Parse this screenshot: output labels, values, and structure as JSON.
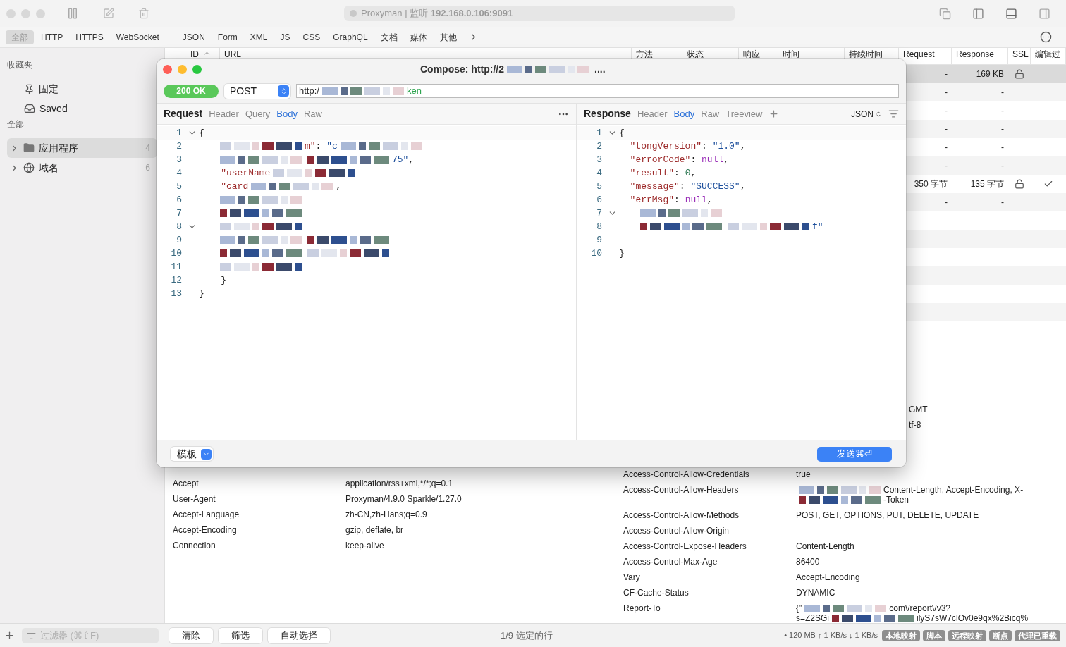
{
  "titlebar": {
    "title": "Proxyman | 监听 **192.168.0.106:9091**"
  },
  "filters": [
    {
      "kind": "tab",
      "label": "全部",
      "selected": true
    },
    {
      "kind": "tab",
      "label": "HTTP",
      "selected": false
    },
    {
      "kind": "tab",
      "label": "HTTPS",
      "selected": false
    },
    {
      "kind": "tab",
      "label": "WebSocket",
      "selected": false
    },
    {
      "kind": "separator"
    },
    {
      "kind": "tab",
      "label": "JSON",
      "selected": false
    },
    {
      "kind": "tab",
      "label": "Form",
      "selected": false
    },
    {
      "kind": "tab",
      "label": "XML",
      "selected": false
    },
    {
      "kind": "tab",
      "label": "JS",
      "selected": false
    },
    {
      "kind": "tab",
      "label": "CSS",
      "selected": false
    },
    {
      "kind": "tab",
      "label": "GraphQL",
      "selected": false
    },
    {
      "kind": "tab",
      "label": "文档",
      "selected": false
    },
    {
      "kind": "tab",
      "label": "媒体",
      "selected": false
    },
    {
      "kind": "tab",
      "label": "其他",
      "selected": false
    }
  ],
  "sidebar": {
    "sections": [
      {
        "title": "收藏夹",
        "items": [
          {
            "kind": "pin",
            "label": "固定",
            "selected": false
          },
          {
            "kind": "tray",
            "label": "Saved",
            "selected": false
          }
        ]
      },
      {
        "title": "全部",
        "items": [
          {
            "kind": "folder",
            "label": "应用程序",
            "count": "4",
            "expanded": false,
            "selected": true
          },
          {
            "kind": "globe",
            "label": "域名",
            "count": "6",
            "expanded": false,
            "selected": false
          }
        ]
      }
    ]
  },
  "table": {
    "columns": [
      {
        "label": "ID"
      },
      {
        "label": "URL"
      },
      {
        "label": "方法"
      },
      {
        "label": "状态"
      },
      {
        "label": "响应"
      },
      {
        "label": "时间"
      },
      {
        "label": "持续时间"
      },
      {
        "label": "Request"
      },
      {
        "label": "Response"
      },
      {
        "label": "SSL"
      },
      {
        "label": "编辑过"
      }
    ],
    "rows": [
      {
        "selected": true,
        "request": "-",
        "response": "169 KB",
        "ssl": true,
        "edited": false
      },
      {
        "selected": false,
        "request": "-",
        "response": "-",
        "ssl": false,
        "edited": false
      },
      {
        "selected": false,
        "request": "-",
        "response": "-",
        "ssl": false,
        "edited": false
      },
      {
        "selected": false,
        "request": "-",
        "response": "-",
        "ssl": false,
        "edited": false
      },
      {
        "selected": false,
        "request": "-",
        "response": "-",
        "ssl": false,
        "edited": false
      },
      {
        "selected": false,
        "request": "-",
        "response": "-",
        "ssl": false,
        "edited": false
      },
      {
        "selected": false,
        "request": "350 字节",
        "response": "135 字节",
        "ssl": true,
        "edited": true
      },
      {
        "selected": false,
        "request": "-",
        "response": "-",
        "ssl": false,
        "edited": false
      }
    ]
  },
  "request_headers": [
    {
      "name": "Accept",
      "value": "application/rss+xml,*/*;q=0.1"
    },
    {
      "name": "User-Agent",
      "value": "Proxyman/4.9.0 Sparkle/1.27.0"
    },
    {
      "name": "Accept-Language",
      "value": "zh-CN,zh-Hans;q=0.9"
    },
    {
      "name": "Accept-Encoding",
      "value": "gzip, deflate, br"
    },
    {
      "name": "Connection",
      "value": "keep-alive"
    }
  ],
  "response_headers_clipped": [
    "GMT",
    "tf-8"
  ],
  "response_headers": [
    {
      "name": "Access-Control-Allow-Credentials",
      "lines": [
        [
          {
            "kind": "text",
            "text": "true"
          }
        ]
      ]
    },
    {
      "name": "Access-Control-Allow-Headers",
      "lines": [
        [
          {
            "kind": "redacted"
          },
          {
            "kind": "text",
            "text": "Content-Length, Accept-Encoding, X-"
          }
        ],
        [
          {
            "kind": "redacted"
          },
          {
            "kind": "text",
            "text": "-Token"
          }
        ]
      ]
    },
    {
      "name": "Access-Control-Allow-Methods",
      "lines": [
        [
          {
            "kind": "text",
            "text": "POST, GET, OPTIONS, PUT, DELETE, UPDATE"
          }
        ]
      ]
    },
    {
      "name": "Access-Control-Allow-Origin"
    },
    {
      "name": "Access-Control-Expose-Headers",
      "lines": [
        [
          {
            "kind": "text",
            "text": "Content-Length"
          }
        ]
      ]
    },
    {
      "name": "Access-Control-Max-Age",
      "lines": [
        [
          {
            "kind": "text",
            "text": "86400"
          }
        ]
      ]
    },
    {
      "name": "Vary",
      "lines": [
        [
          {
            "kind": "text",
            "text": "Accept-Encoding"
          }
        ]
      ]
    },
    {
      "name": "CF-Cache-Status",
      "lines": [
        [
          {
            "kind": "text",
            "text": "DYNAMIC"
          }
        ]
      ]
    },
    {
      "name": "Report-To",
      "lines": [
        [
          {
            "kind": "text",
            "text": "{\""
          },
          {
            "kind": "redacted"
          },
          {
            "kind": "text",
            "text": "com\\/report\\/v3?"
          }
        ],
        [
          {
            "kind": "text",
            "text": "s=Z2SGi"
          },
          {
            "kind": "redacted"
          },
          {
            "kind": "text",
            "text": "ilyS7sW7clOv0e9qx%2Bicq%"
          }
        ]
      ]
    }
  ],
  "compose": {
    "title": "Compose: http://2",
    "title_tail": "....",
    "status": "200 OK",
    "method": "POST",
    "url_start": "http:/",
    "url_end": "ken",
    "request": {
      "title": "Request",
      "tabs": [
        {
          "label": "Header",
          "selected": false
        },
        {
          "label": "Query",
          "selected": false
        },
        {
          "label": "Body",
          "selected": true
        },
        {
          "label": "Raw",
          "selected": false
        }
      ],
      "lines": [
        {
          "n": "1",
          "fold": true,
          "segs": [
            {
              "kind": "punct",
              "text": "{"
            }
          ]
        },
        {
          "n": "2",
          "fold": false,
          "segs": [
            {
              "kind": "redacted"
            },
            {
              "kind": "key",
              "text": "m\""
            },
            {
              "kind": "punct",
              "text": ": "
            },
            {
              "kind": "string",
              "text": "\"c"
            },
            {
              "kind": "redacted"
            }
          ]
        },
        {
          "n": "3",
          "fold": false,
          "segs": [
            {
              "kind": "redacted"
            },
            {
              "kind": "redacted"
            },
            {
              "kind": "string",
              "text": "75\""
            },
            {
              "kind": "punct",
              "text": ","
            }
          ]
        },
        {
          "n": "4",
          "fold": false,
          "segs": [
            {
              "kind": "key",
              "text": "    \"userName"
            },
            {
              "kind": "redacted"
            }
          ]
        },
        {
          "n": "5",
          "fold": false,
          "segs": [
            {
              "kind": "key",
              "text": "    \"card"
            },
            {
              "kind": "redacted"
            },
            {
              "kind": "punct",
              "text": ","
            }
          ]
        },
        {
          "n": "6",
          "fold": false,
          "segs": [
            {
              "kind": "redacted"
            }
          ]
        },
        {
          "n": "7",
          "fold": false,
          "segs": [
            {
              "kind": "redacted"
            }
          ]
        },
        {
          "n": "8",
          "fold": true,
          "segs": [
            {
              "kind": "redacted"
            }
          ]
        },
        {
          "n": "9",
          "fold": false,
          "segs": [
            {
              "kind": "redacted"
            },
            {
              "kind": "redacted"
            }
          ]
        },
        {
          "n": "10",
          "fold": false,
          "segs": [
            {
              "kind": "redacted"
            },
            {
              "kind": "redacted"
            }
          ]
        },
        {
          "n": "11",
          "fold": false,
          "segs": [
            {
              "kind": "redacted"
            }
          ]
        },
        {
          "n": "12",
          "fold": false,
          "segs": [
            {
              "kind": "punct",
              "text": "    }"
            }
          ]
        },
        {
          "n": "13",
          "fold": false,
          "segs": [
            {
              "kind": "punct",
              "text": "}"
            }
          ]
        }
      ]
    },
    "response": {
      "title": "Response",
      "tabs": [
        {
          "label": "Header",
          "selected": false
        },
        {
          "label": "Body",
          "selected": true
        },
        {
          "label": "Raw",
          "selected": false
        },
        {
          "label": "Treeview",
          "selected": false
        }
      ],
      "format": "JSON",
      "lines": [
        {
          "n": "1",
          "fold": true,
          "segs": [
            {
              "kind": "punct",
              "text": "{"
            }
          ]
        },
        {
          "n": "2",
          "fold": false,
          "segs": [
            {
              "kind": "key",
              "text": "  \"tongVersion\""
            },
            {
              "kind": "punct",
              "text": ": "
            },
            {
              "kind": "string",
              "text": "\"1.0\""
            },
            {
              "kind": "punct",
              "text": ","
            }
          ]
        },
        {
          "n": "3",
          "fold": false,
          "segs": [
            {
              "kind": "key",
              "text": "  \"errorCode\""
            },
            {
              "kind": "punct",
              "text": ": "
            },
            {
              "kind": "null",
              "text": "null"
            },
            {
              "kind": "punct",
              "text": ","
            }
          ]
        },
        {
          "n": "4",
          "fold": false,
          "segs": [
            {
              "kind": "key",
              "text": "  \"result\""
            },
            {
              "kind": "punct",
              "text": ": "
            },
            {
              "kind": "number",
              "text": "0"
            },
            {
              "kind": "punct",
              "text": ","
            }
          ]
        },
        {
          "n": "5",
          "fold": false,
          "segs": [
            {
              "kind": "key",
              "text": "  \"message\""
            },
            {
              "kind": "punct",
              "text": ": "
            },
            {
              "kind": "string",
              "text": "\"SUCCESS\""
            },
            {
              "kind": "punct",
              "text": ","
            }
          ]
        },
        {
          "n": "6",
          "fold": false,
          "segs": [
            {
              "kind": "key",
              "text": "  \"errMsg\""
            },
            {
              "kind": "punct",
              "text": ": "
            },
            {
              "kind": "null",
              "text": "null"
            },
            {
              "kind": "punct",
              "text": ","
            }
          ]
        },
        {
          "n": "7",
          "fold": true,
          "segs": [
            {
              "kind": "redacted"
            }
          ]
        },
        {
          "n": "8",
          "fold": false,
          "segs": [
            {
              "kind": "redacted"
            },
            {
              "kind": "redacted"
            },
            {
              "kind": "string",
              "text": "f\""
            }
          ]
        },
        {
          "n": "9",
          "fold": false
        },
        {
          "n": "10",
          "fold": false,
          "segs": [
            {
              "kind": "punct",
              "text": "}"
            }
          ]
        }
      ]
    },
    "template": "模板",
    "send": "发送⌘⏎"
  },
  "bottom": {
    "filter_placeholder": "过滤器 (⌘⇧F)",
    "buttons": [
      "清除",
      "筛选",
      "自动选择"
    ],
    "selection": "1/9 选定的行",
    "stats": "• 120 MB ↑ 1 KB/s ↓ 1 KB/s",
    "badges": [
      "本地映射",
      "脚本",
      "远程映射",
      "断点",
      "代理已重载"
    ]
  }
}
